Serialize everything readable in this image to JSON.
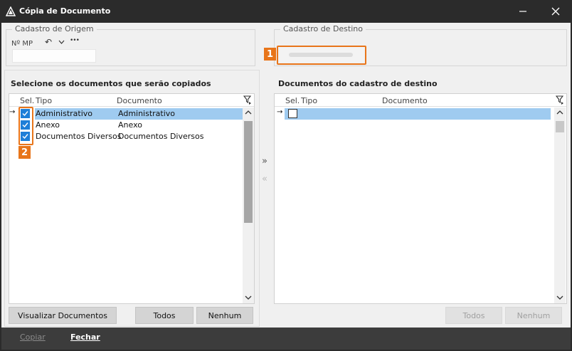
{
  "window": {
    "title": "Cópia de Documento",
    "minimize_icon": "minimize-icon",
    "close_icon": "close-icon"
  },
  "origem": {
    "legend": "Cadastro de Origem",
    "mp_label": "Nº MP",
    "undo_icon": "undo-icon",
    "dropdown_icon": "chevron-down-icon",
    "more_label": "•••"
  },
  "destino": {
    "legend": "Cadastro de Destino"
  },
  "left_panel": {
    "title": "Selecione os documentos que serão copiados",
    "columns": [
      "Sel.",
      "Tipo",
      "Documento"
    ],
    "rows": [
      {
        "tipo": "Administrativo",
        "documento": "Administrativo",
        "checked": true,
        "selected": true
      },
      {
        "tipo": "Anexo",
        "documento": "Anexo",
        "checked": true,
        "selected": false
      },
      {
        "tipo": "Documentos Diversos",
        "documento": "Documentos Diversos",
        "checked": true,
        "selected": false
      }
    ],
    "scroll_up": "▲",
    "scroll_down": "⌄"
  },
  "right_panel": {
    "title": "Documentos do cadastro de destino",
    "columns": [
      "Sel.",
      "Tipo",
      "Documento"
    ]
  },
  "buttons": {
    "visualizar": "Visualizar Documentos",
    "todos_left": "Todos",
    "nenhum_left": "Nenhum",
    "todos_right": "Todos",
    "nenhum_right": "Nenhum",
    "move_right": "»",
    "move_left": "«"
  },
  "footer": {
    "copiar": "Copiar",
    "fechar": "Fechar"
  },
  "annotations": {
    "badge1": "1",
    "badge2": "2"
  },
  "colors": {
    "accent_orange": "#e8751a",
    "selection_blue": "#9fcbf0",
    "check_blue": "#1e7fd8"
  }
}
